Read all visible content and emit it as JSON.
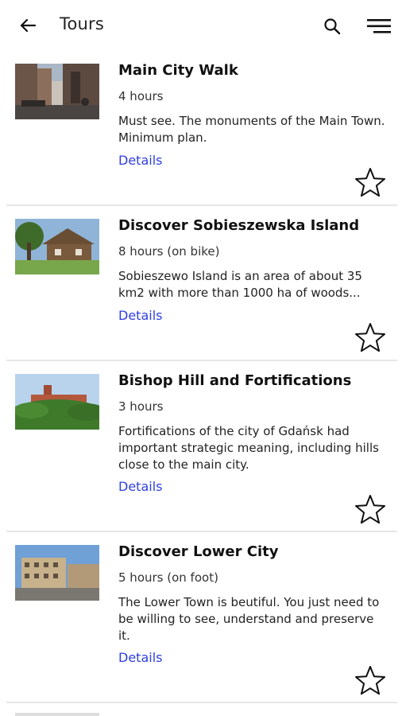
{
  "header": {
    "title": "Tours",
    "icons": [
      "back-arrow-icon",
      "search-icon",
      "menu-icon"
    ]
  },
  "details_label": "Details",
  "tours": [
    {
      "title": "Main City Walk",
      "duration": "4 hours",
      "description": "Must see. The monuments of the Main Town. Minimum plan.",
      "image": "city-street-photo"
    },
    {
      "title": "Discover Sobieszewska Island",
      "duration": "8 hours (on bike)",
      "description": "Sobieszewo Island is an area of about 35 km2 with more than 1000 ha of woods...",
      "image": "wooden-house-photo"
    },
    {
      "title": "Bishop Hill and Fortifications",
      "duration": "3 hours",
      "description": "Fortifications of the city of Gdańsk had important strategic meaning, including hills close to the main city.",
      "image": "hill-building-photo"
    },
    {
      "title": "Discover Lower City",
      "duration": "5 hours (on foot)",
      "description": "The Lower Town is beutiful. You just need to be willing to see, understand and preserve it.",
      "image": "lower-city-photo"
    }
  ],
  "colors": {
    "link": "#2f3fe0",
    "divider": "#e6e6e6"
  }
}
